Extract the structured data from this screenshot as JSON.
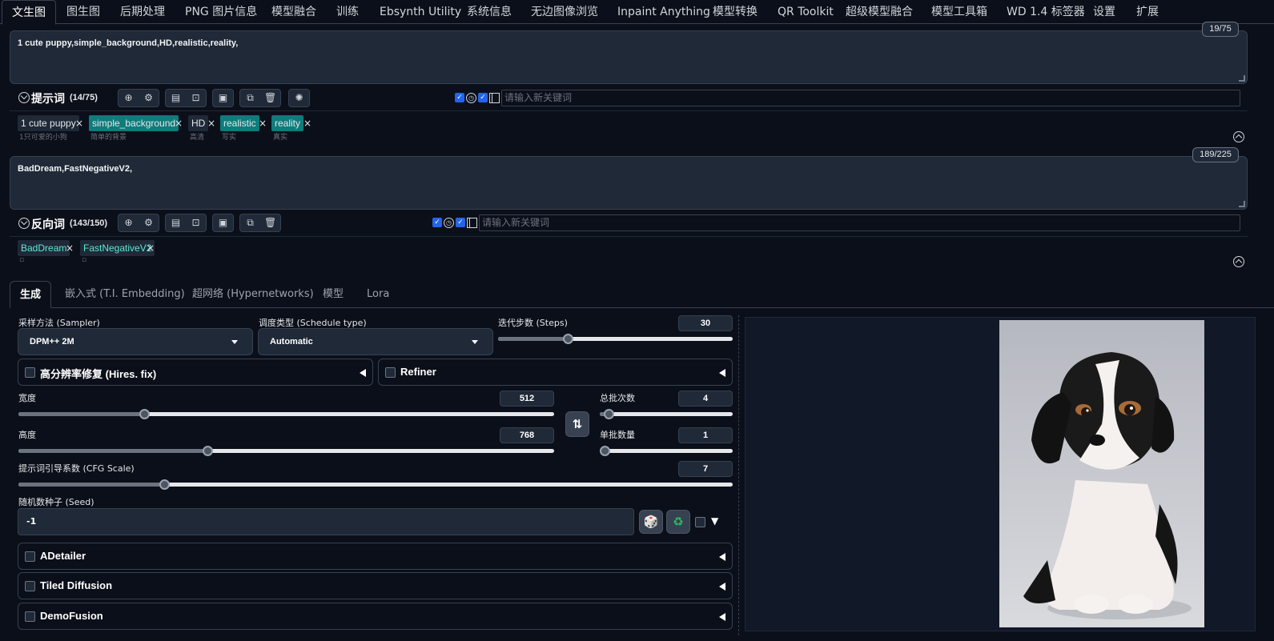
{
  "top_tabs": [
    {
      "label": "文生图"
    },
    {
      "label": "图生图"
    },
    {
      "label": "后期处理"
    },
    {
      "label": "PNG 图片信息"
    },
    {
      "label": "模型融合"
    },
    {
      "label": "训练"
    },
    {
      "label": "Ebsynth Utility"
    },
    {
      "label": "系统信息"
    },
    {
      "label": "无边图像浏览"
    },
    {
      "label": "Inpaint Anything"
    },
    {
      "label": "模型转换"
    },
    {
      "label": "QR Toolkit"
    },
    {
      "label": "超级模型融合"
    },
    {
      "label": "模型工具箱"
    },
    {
      "label": "WD 1.4 标签器"
    },
    {
      "label": "设置"
    },
    {
      "label": "扩展"
    }
  ],
  "positive": {
    "text": "1 cute puppy,simple_background,HD,realistic,reality,",
    "token_count": "19/75",
    "title": "提示词",
    "count": "(14/75)",
    "keyword_placeholder": "请输入新关键词",
    "tags": [
      {
        "label": "1 cute puppy",
        "sub": "1只可爱的小狗"
      },
      {
        "label": "simple_background",
        "sub": "简单的背景"
      },
      {
        "label": "HD",
        "sub": "高清"
      },
      {
        "label": "realistic",
        "sub": "写实"
      },
      {
        "label": "reality",
        "sub": "真实"
      }
    ]
  },
  "negative": {
    "text": "BadDream,FastNegativeV2,",
    "token_count": "189/225",
    "title": "反向词",
    "count": "(143/150)",
    "keyword_placeholder": "请输入新关键词",
    "tags": [
      {
        "label": "BadDream"
      },
      {
        "label": "FastNegativeV2"
      }
    ]
  },
  "sub_tabs": [
    {
      "label": "生成"
    },
    {
      "label": "嵌入式 (T.I. Embedding)"
    },
    {
      "label": "超网络 (Hypernetworks)"
    },
    {
      "label": "模型"
    },
    {
      "label": "Lora"
    }
  ],
  "generation": {
    "sampler_label": "采样方法 (Sampler)",
    "sampler_value": "DPM++ 2M",
    "schedule_label": "调度类型 (Schedule type)",
    "schedule_value": "Automatic",
    "steps_label": "迭代步数 (Steps)",
    "steps_value": "30",
    "hires_label": "高分辨率修复 (Hires. fix)",
    "refiner_label": "Refiner",
    "width_label": "宽度",
    "width_value": "512",
    "height_label": "高度",
    "height_value": "768",
    "batch_count_label": "总批次数",
    "batch_count_value": "4",
    "batch_size_label": "单批数量",
    "batch_size_value": "1",
    "cfg_label": "提示词引导系数 (CFG Scale)",
    "cfg_value": "7",
    "seed_label": "随机数种子 (Seed)",
    "seed_value": "-1"
  },
  "sliders": {
    "steps": 0.29,
    "width": 0.23,
    "height": 0.35,
    "batch_count": 0.03,
    "batch_size": 0.0,
    "cfg": 0.2
  },
  "accordions": [
    {
      "label": "ADetailer"
    },
    {
      "label": "Tiled Diffusion"
    },
    {
      "label": "DemoFusion"
    }
  ],
  "colors": {
    "background": "#0b0f19",
    "panel": "#1f2937",
    "teal_tag": "#0e7c7b",
    "checkbox": "#2563eb"
  }
}
